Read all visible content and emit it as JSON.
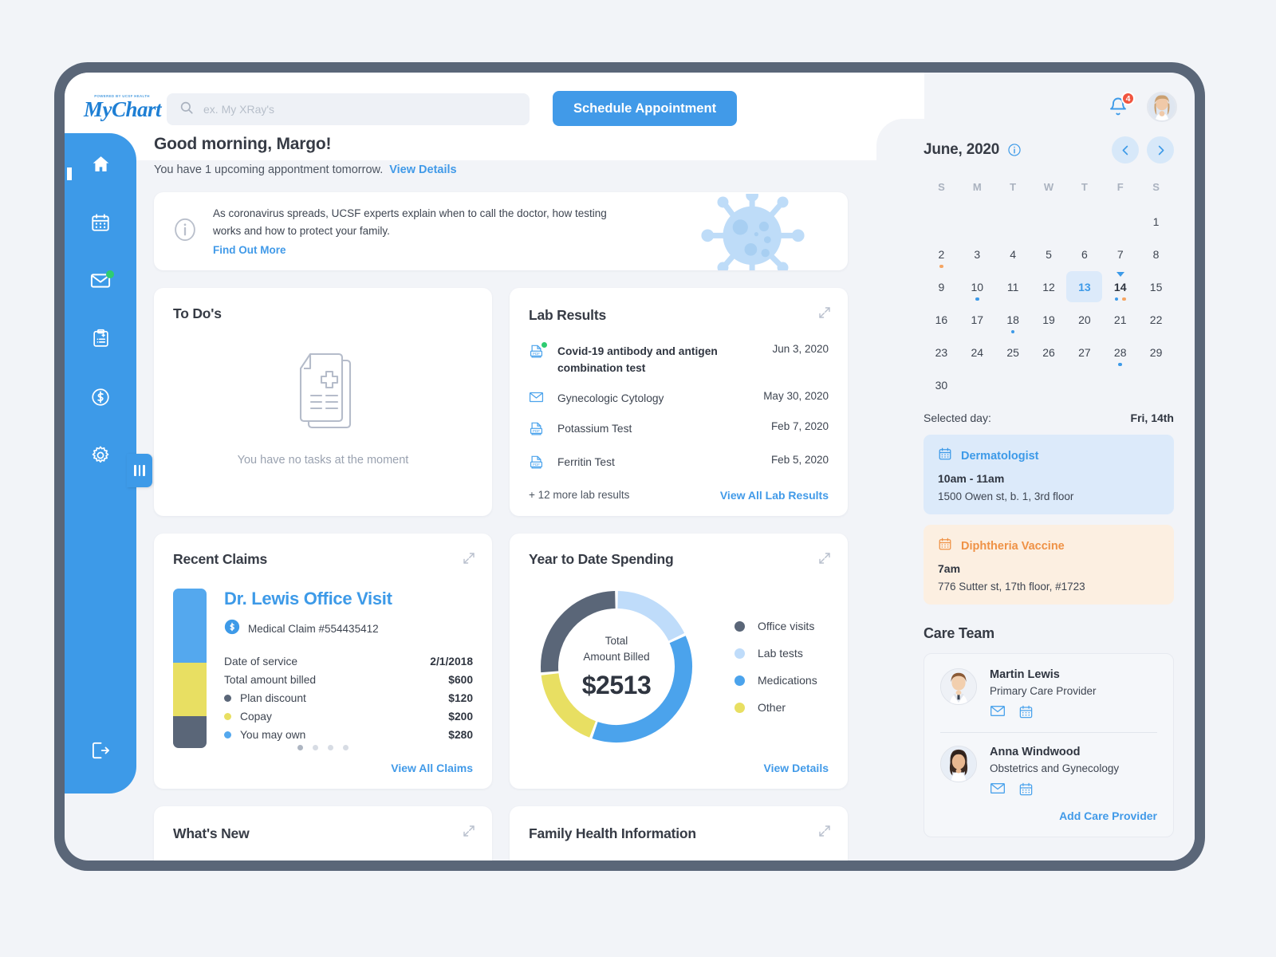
{
  "brand": {
    "logo_sub": "POWERED BY UCSF HEALTH",
    "logo_main": "MyChart",
    "accent_blue": "#3d9ae8",
    "link_blue": "#419ae8",
    "yellow": "#e8df62",
    "slate": "#5a6678",
    "light_blue": "#bfdcfa",
    "orange": "#ef9246",
    "green": "#2ecc71",
    "red": "#f1543f"
  },
  "topbar": {
    "search_placeholder": "ex. My XRay's",
    "schedule_button": "Schedule Appointment",
    "notification_count": "4"
  },
  "sidebar": {
    "items": [
      {
        "name": "home",
        "label": "Home",
        "badge": false
      },
      {
        "name": "calendar",
        "label": "Appointments",
        "badge": false
      },
      {
        "name": "messages",
        "label": "Messages",
        "badge": true
      },
      {
        "name": "records",
        "label": "Medical Records",
        "badge": false
      },
      {
        "name": "billing",
        "label": "Billing",
        "badge": false
      },
      {
        "name": "settings",
        "label": "Settings",
        "badge": false
      }
    ],
    "logout_label": "Log out"
  },
  "header": {
    "greeting": "Good morning, Margo!",
    "subtext": "You have 1 upcoming appontment tomorrow.",
    "view_details": "View Details"
  },
  "banner": {
    "text": "As coronavirus spreads, UCSF experts explain when to call the doctor, how testing works and how to protect your family.",
    "link": "Find Out More"
  },
  "todos": {
    "title": "To Do's",
    "empty_text": "You have no tasks at the moment"
  },
  "lab_results": {
    "title": "Lab Results",
    "items": [
      {
        "name": "Covid-19 antibody and antigen combination test",
        "date": "Jun 3, 2020",
        "icon": "pdf-icon",
        "unread": true
      },
      {
        "name": "Gynecologic Cytology",
        "date": "May 30, 2020",
        "icon": "mail-icon",
        "unread": false
      },
      {
        "name": "Potassium Test",
        "date": "Feb 7, 2020",
        "icon": "pdf-icon",
        "unread": false
      },
      {
        "name": "Ferritin Test",
        "date": "Feb 5, 2020",
        "icon": "pdf-icon",
        "unread": false
      }
    ],
    "more_text": "+ 12 more lab results",
    "link": "View All Lab Results"
  },
  "recent_claims": {
    "title": "Recent Claims",
    "claim_title": "Dr. Lewis Office Visit",
    "claim_number": "Medical Claim #554435412",
    "rows": [
      {
        "label": "Date of service",
        "value": "2/1/2018",
        "dot": null
      },
      {
        "label": "Total amount billed",
        "value": "$600",
        "dot": null
      },
      {
        "label": "Plan discount",
        "value": "$120",
        "dot": "#5a6678"
      },
      {
        "label": "Copay",
        "value": "$200",
        "dot": "#e8df62"
      },
      {
        "label": "You may own",
        "value": "$280",
        "dot": "#54a8ee"
      }
    ],
    "bar_segments": [
      {
        "name": "You may own",
        "color": "#54a8ee",
        "pct": 46.7
      },
      {
        "name": "Copay",
        "color": "#e8df62",
        "pct": 33.3
      },
      {
        "name": "Plan discount",
        "color": "#5a6678",
        "pct": 20
      }
    ],
    "page_count": 4,
    "page_active": 0,
    "link": "View All Claims"
  },
  "chart_data": {
    "type": "pie",
    "title": "Year to Date Spending",
    "center_label": "Total\nAmount Billed",
    "center_value": "$2513",
    "total": 2513,
    "categories": [
      "Office visits",
      "Lab tests",
      "Medications",
      "Other"
    ],
    "values": [
      665,
      452,
      942,
      454
    ],
    "percentages": [
      26.5,
      18.0,
      37.5,
      18.0
    ],
    "colors": [
      "#5a6678",
      "#bfdcfa",
      "#4ba3ec",
      "#e8df62"
    ],
    "legend_position": "right",
    "donut": true,
    "link": "View Details"
  },
  "bottom_cards": [
    {
      "title": "What's New"
    },
    {
      "title": "Family Health Information"
    }
  ],
  "calendar": {
    "month_label": "June, 2020",
    "dow": [
      "S",
      "M",
      "T",
      "W",
      "T",
      "F",
      "S"
    ],
    "prev_label": "Previous month",
    "next_label": "Next month",
    "leading_blanks": 6,
    "days": [
      {
        "n": "1"
      },
      {
        "n": "2",
        "dots": [
          "orange"
        ]
      },
      {
        "n": "3"
      },
      {
        "n": "4"
      },
      {
        "n": "5"
      },
      {
        "n": "6"
      },
      {
        "n": "7"
      },
      {
        "n": "8"
      },
      {
        "n": "9"
      },
      {
        "n": "10",
        "dots": [
          "blue"
        ]
      },
      {
        "n": "11"
      },
      {
        "n": "12"
      },
      {
        "n": "13",
        "selected": true
      },
      {
        "n": "14",
        "bold": true,
        "triangle": true,
        "dots": [
          "blue",
          "orange"
        ]
      },
      {
        "n": "15"
      },
      {
        "n": "16"
      },
      {
        "n": "17"
      },
      {
        "n": "18",
        "dots": [
          "blue"
        ]
      },
      {
        "n": "19"
      },
      {
        "n": "20"
      },
      {
        "n": "21"
      },
      {
        "n": "22"
      },
      {
        "n": "23"
      },
      {
        "n": "24"
      },
      {
        "n": "25"
      },
      {
        "n": "26"
      },
      {
        "n": "27"
      },
      {
        "n": "28",
        "dots": [
          "blue"
        ]
      },
      {
        "n": "29"
      },
      {
        "n": "30"
      }
    ],
    "selected_day_label": "Selected day:",
    "selected_day_value": "Fri, 14th",
    "appointments": [
      {
        "title": "Dermatologist",
        "time": "10am - 11am",
        "address": "1500 Owen st, b. 1, 3rd floor",
        "tone": "blue"
      },
      {
        "title": "Diphtheria Vaccine",
        "time": "7am",
        "address": "776 Sutter st, 17th floor, #1723",
        "tone": "orange"
      }
    ]
  },
  "care_team": {
    "title": "Care Team",
    "members": [
      {
        "name": "Martin Lewis",
        "role": "Primary Care Provider",
        "avatar": "male-doctor"
      },
      {
        "name": "Anna Windwood",
        "role": "Obstetrics and Gynecology",
        "avatar": "female-doctor"
      }
    ],
    "add_link": "Add Care Provider"
  }
}
